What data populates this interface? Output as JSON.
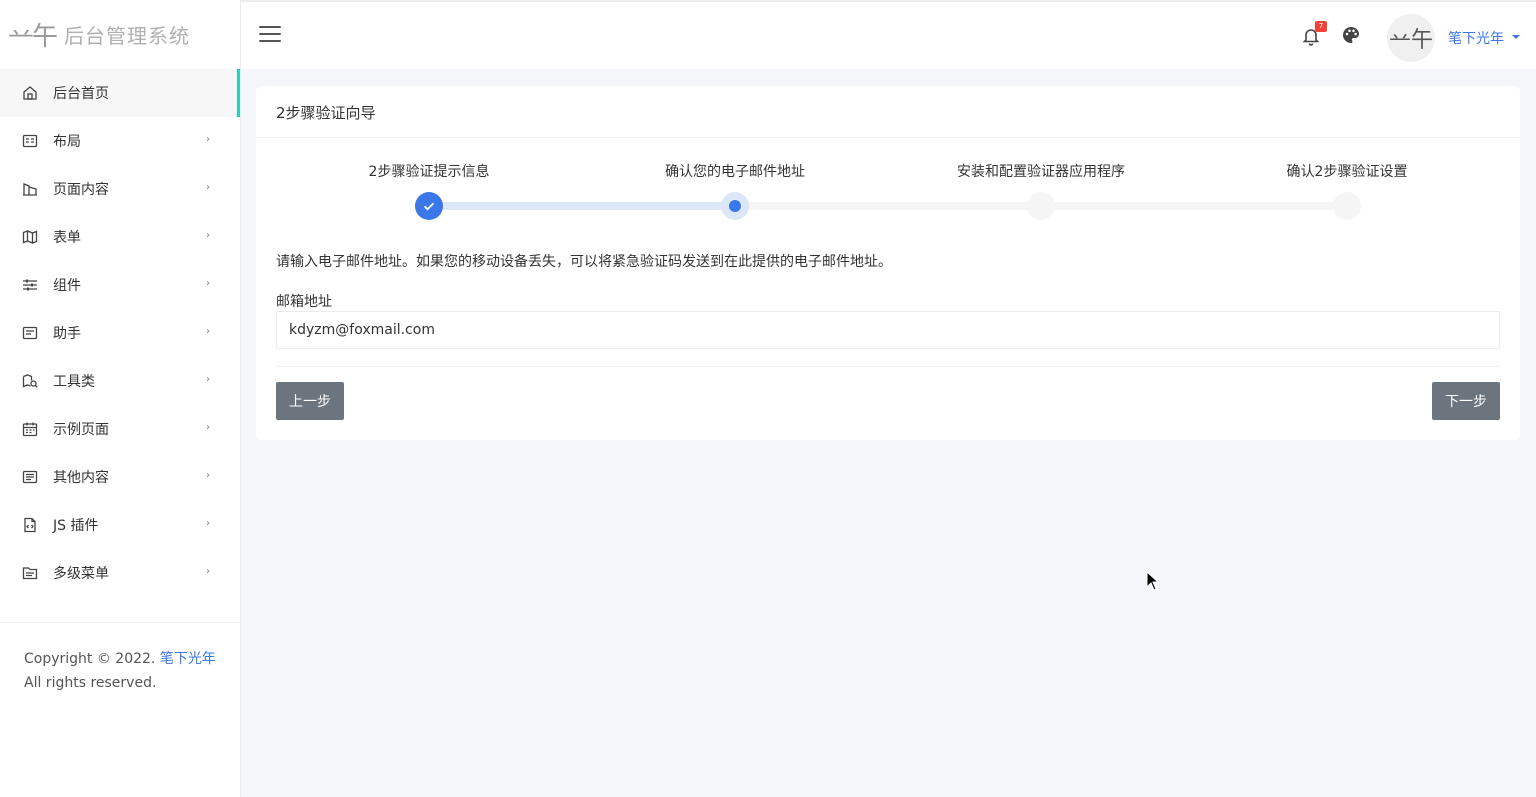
{
  "brand": {
    "logo_mark": "䒑午",
    "title": "后台管理系统"
  },
  "sidebar": {
    "items": [
      {
        "label": "后台首页",
        "icon": "home-icon",
        "active": true,
        "has_children": false
      },
      {
        "label": "布局",
        "icon": "layout-icon",
        "has_children": true
      },
      {
        "label": "页面内容",
        "icon": "pages-icon",
        "has_children": true
      },
      {
        "label": "表单",
        "icon": "map-icon",
        "has_children": true
      },
      {
        "label": "组件",
        "icon": "sliders-icon",
        "has_children": true
      },
      {
        "label": "助手",
        "icon": "card-icon",
        "has_children": true
      },
      {
        "label": "工具类",
        "icon": "tool-icon",
        "has_children": true
      },
      {
        "label": "示例页面",
        "icon": "calendar-icon",
        "has_children": true
      },
      {
        "label": "其他内容",
        "icon": "list-icon",
        "has_children": true
      },
      {
        "label": "JS 插件",
        "icon": "code-file-icon",
        "has_children": true
      },
      {
        "label": "多级菜单",
        "icon": "folder-icon",
        "has_children": true
      }
    ],
    "arrow_glyph": "›",
    "footer": {
      "prefix": "Copyright © 2022.",
      "link": "笔下光年",
      "suffix": "All rights reserved."
    }
  },
  "header": {
    "notification_count": "7",
    "avatar_text": "䒑午",
    "user_name": "笔下光年"
  },
  "wizard": {
    "title": "2步骤验证向导",
    "steps": [
      {
        "label": "2步骤验证提示信息",
        "state": "done"
      },
      {
        "label": "确认您的电子邮件地址",
        "state": "current"
      },
      {
        "label": "安装和配置验证器应用程序",
        "state": "todo"
      },
      {
        "label": "确认2步骤验证设置",
        "state": "todo"
      }
    ],
    "description": "请输入电子邮件地址。如果您的移动设备丢失，可以将紧急验证码发送到在此提供的电子邮件地址。",
    "email_label": "邮箱地址",
    "email_value": "kdyzm@foxmail.com",
    "prev_label": "上一步",
    "next_label": "下一步"
  },
  "colors": {
    "accent": "#3b78e7",
    "active_bar": "#33cabb",
    "button": "#6c757d",
    "badge": "#f44336"
  }
}
